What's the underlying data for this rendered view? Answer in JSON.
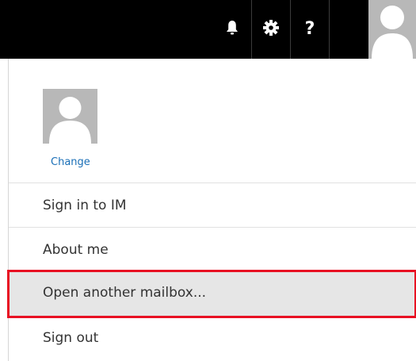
{
  "header": {
    "icons": [
      "bell-icon",
      "gear-icon",
      "help-icon",
      "avatar"
    ],
    "help_glyph": "?",
    "background": "#000000"
  },
  "profile": {
    "change_label": "Change"
  },
  "menu": {
    "items": [
      {
        "label": "Sign in to IM"
      },
      {
        "label": "About me"
      },
      {
        "label": "Open another mailbox...",
        "highlighted": true
      },
      {
        "label": "Sign out"
      }
    ]
  },
  "colors": {
    "link": "#1a6fb7",
    "highlight_border": "#e81123",
    "hover_bg": "#e6e6e6",
    "avatar_bg": "#b8b8b8"
  }
}
